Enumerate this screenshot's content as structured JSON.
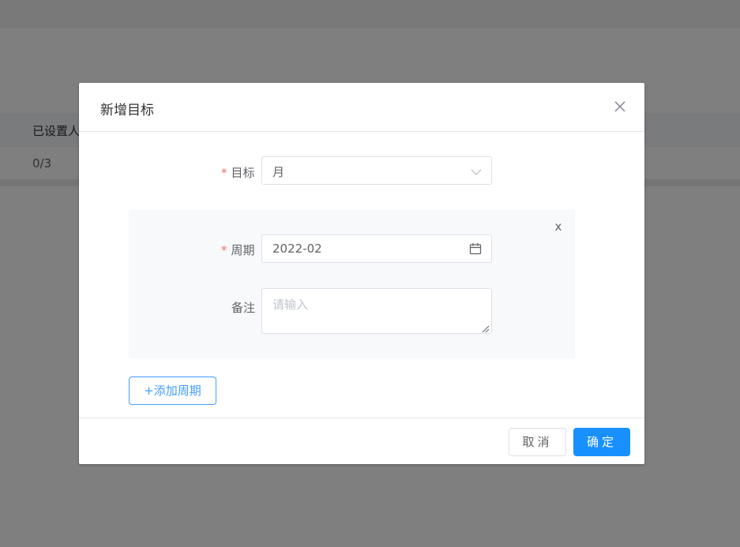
{
  "background": {
    "table_header": "已设置人",
    "table_cell": "0/3"
  },
  "dialog": {
    "title": "新增目标",
    "close_icon": "close-icon",
    "target": {
      "label": "目标",
      "required_mark": "*",
      "value": "月",
      "dropdown_icon": "chevron-down-icon"
    },
    "period_card": {
      "remove_label": "x",
      "period": {
        "label": "周期",
        "required_mark": "*",
        "value": "2022-02",
        "icon": "calendar-icon"
      },
      "note": {
        "label": "备注",
        "placeholder": "请输入",
        "value": ""
      }
    },
    "add_period_label": "+添加周期",
    "footer": {
      "cancel_label": "取消",
      "confirm_label": "确定"
    },
    "colors": {
      "primary": "#1890ff",
      "required": "#f56c6c",
      "card_bg": "#f8f9fb"
    }
  }
}
